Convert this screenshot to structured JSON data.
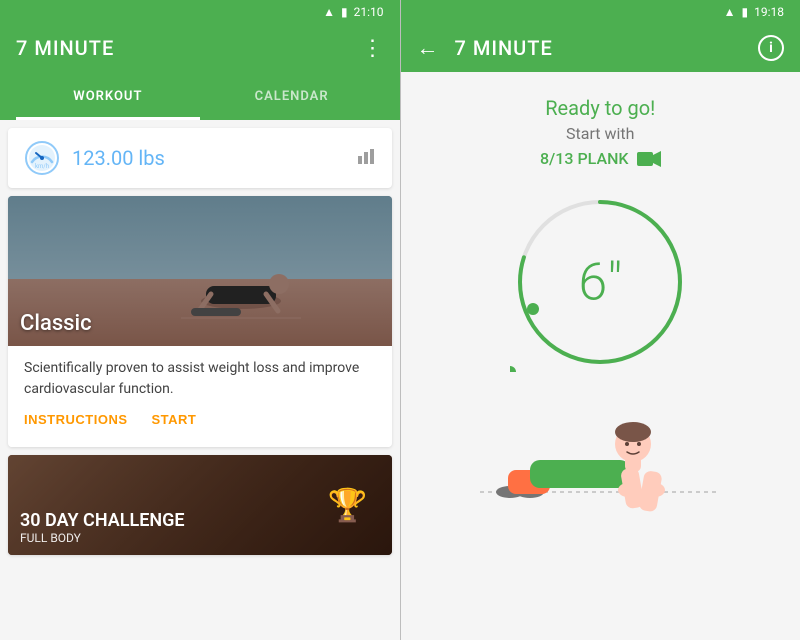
{
  "left": {
    "statusBar": {
      "time": "21:10",
      "signal": "▲",
      "battery": "🔋"
    },
    "header": {
      "title": "7 MINUTE",
      "moreLabel": "⋮"
    },
    "tabs": [
      {
        "id": "workout",
        "label": "WORKOUT",
        "active": true
      },
      {
        "id": "calendar",
        "label": "CALENDAR",
        "active": false
      }
    ],
    "weightCard": {
      "value": "123.00 lbs",
      "chartIcon": "📊"
    },
    "workoutCard": {
      "label": "Classic",
      "description": "Scientifically proven to assist weight loss and improve cardiovascular function.",
      "instructionsBtn": "INSTRUCTIONS",
      "startBtn": "START"
    },
    "challengeCard": {
      "mainText": "30 DAY CHALLENGE",
      "subText": "FULL BODY",
      "trophyIcon": "🏆"
    }
  },
  "right": {
    "statusBar": {
      "time": "19:18",
      "signal": "▲",
      "battery": "🔋"
    },
    "header": {
      "title": "7 MINUTE",
      "backIcon": "←",
      "infoIcon": "i"
    },
    "content": {
      "readyText": "Ready to go!",
      "startWithText": "Start with",
      "exerciseName": "8/13 PLANK",
      "videoIcon": "▶",
      "timerValue": "6\"",
      "timerUnit": "\""
    }
  }
}
